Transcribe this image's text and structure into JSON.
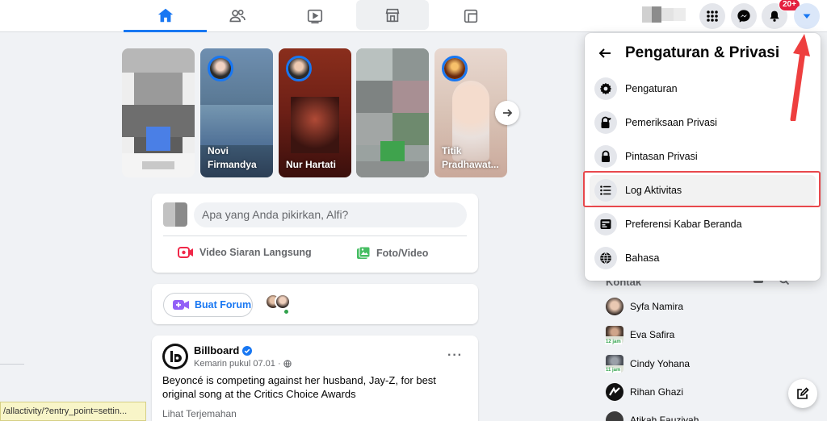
{
  "topbar": {
    "nav_tabs": [
      {
        "name": "home",
        "icon": "home-icon",
        "active": true
      },
      {
        "name": "friends",
        "icon": "friends-icon",
        "active": false
      },
      {
        "name": "watch",
        "icon": "video-icon",
        "active": false
      },
      {
        "name": "marketplace",
        "icon": "store-icon",
        "active": false
      },
      {
        "name": "gaming",
        "icon": "gaming-icon",
        "active": false
      }
    ],
    "notifications_badge": "20+",
    "accent_color": "#1877f2"
  },
  "stories": [
    {
      "name": ""
    },
    {
      "name_line1": "Novi",
      "name_line2": "Firmandya"
    },
    {
      "name_line1": "Nur Hartati",
      "name_line2": ""
    },
    {
      "name": ""
    },
    {
      "name_line1": "Titik",
      "name_line2": "Pradhawat..."
    }
  ],
  "composer": {
    "placeholder": "Apa yang Anda pikirkan, Alfi?",
    "live_label": "Video Siaran Langsung",
    "photo_label": "Foto/Video"
  },
  "forum": {
    "button_label": "Buat Forum"
  },
  "post": {
    "author": "Billboard",
    "meta": "Kemarin pukul 07.01 ·",
    "text": "Beyoncé is competing against her husband, Jay-Z, for best original song at the Critics Choice Awards",
    "translate": "Lihat Terjemahan",
    "more": "···"
  },
  "status_bar": {
    "url": "/allactivity/?entry_point=settin..."
  },
  "contacts": {
    "title": "Kontak",
    "items": [
      {
        "name": "Syfa Namira",
        "time": ""
      },
      {
        "name": "Eva Safira",
        "time": "12 jam"
      },
      {
        "name": "Cindy Yohana",
        "time": "11 jam"
      },
      {
        "name": "Rihan Ghazi",
        "time": ""
      },
      {
        "name": "Atikah Fauziyah",
        "time": ""
      }
    ]
  },
  "panel": {
    "title": "Pengaturan & Privasi",
    "items": [
      {
        "label": "Pengaturan",
        "icon": "gear-icon"
      },
      {
        "label": "Pemeriksaan Privasi",
        "icon": "lock-heart-icon"
      },
      {
        "label": "Pintasan Privasi",
        "icon": "lock-icon"
      },
      {
        "label": "Log Aktivitas",
        "icon": "list-icon"
      },
      {
        "label": "Preferensi Kabar Beranda",
        "icon": "feed-icon"
      },
      {
        "label": "Bahasa",
        "icon": "globe-icon"
      }
    ],
    "highlight_color": "#e8484c"
  }
}
